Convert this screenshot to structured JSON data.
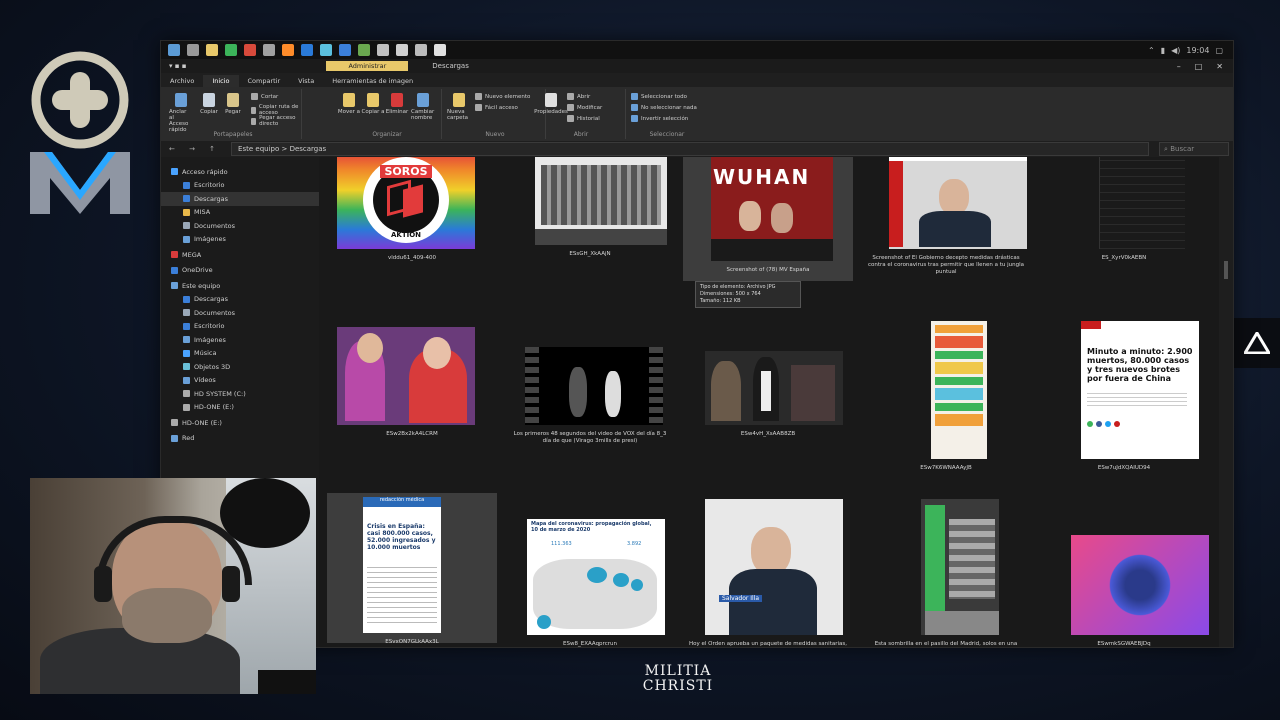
{
  "overlay": {
    "brand_text_line1": "MILITIA",
    "brand_text_line2": "CHRISTI"
  },
  "window": {
    "context_tab": "Administrar",
    "window_title": "Descargas",
    "controls": {
      "minimize": "–",
      "maximize": "□",
      "close": "✕"
    },
    "clock": "19:04",
    "ribbon_tabs": [
      "Archivo",
      "Inicio",
      "Compartir",
      "Vista",
      "Herramientas de imagen"
    ],
    "active_tab_index": 1
  },
  "ribbon": {
    "groups": [
      {
        "name": "Portapapeles",
        "buttons": [
          "Anclar al Acceso rápido",
          "Copiar",
          "Pegar"
        ],
        "small": [
          "Cortar",
          "Copiar ruta de acceso",
          "Pegar acceso directo"
        ]
      },
      {
        "name": "Organizar",
        "buttons": [
          "Mover a",
          "Copiar a",
          "Eliminar",
          "Cambiar nombre"
        ]
      },
      {
        "name": "Nuevo",
        "buttons": [
          "Nueva carpeta"
        ],
        "small": [
          "Nuevo elemento",
          "Fácil acceso"
        ]
      },
      {
        "name": "Abrir",
        "buttons": [
          "Propiedades"
        ],
        "small": [
          "Abrir",
          "Modificar",
          "Historial"
        ]
      },
      {
        "name": "Seleccionar",
        "small": [
          "Seleccionar todo",
          "No seleccionar nada",
          "Invertir selección"
        ]
      }
    ]
  },
  "address": {
    "nav": "← → ↑",
    "path": "Este equipo  >  Descargas",
    "search_placeholder": "Buscar"
  },
  "nav_pane": {
    "items": [
      {
        "label": "Acceso rápido",
        "color": "#4aa3ff",
        "indent": 1,
        "selected": false
      },
      {
        "label": "Escritorio",
        "color": "#3b7fd9",
        "indent": 2,
        "selected": false
      },
      {
        "label": "Descargas",
        "color": "#3b7fd9",
        "indent": 2,
        "selected": true
      },
      {
        "label": "MISA",
        "color": "#e8b84a",
        "indent": 2,
        "selected": false
      },
      {
        "label": "Documentos",
        "color": "#9aa8b8",
        "indent": 2,
        "selected": false
      },
      {
        "label": "Imágenes",
        "color": "#6aa0d8",
        "indent": 2,
        "selected": false
      },
      {
        "label": "MEGA",
        "color": "#d83b3b",
        "indent": 1,
        "selected": false
      },
      {
        "label": "OneDrive",
        "color": "#3b7fd9",
        "indent": 1,
        "selected": false
      },
      {
        "label": "Este equipo",
        "color": "#6aa0d8",
        "indent": 1,
        "selected": false
      },
      {
        "label": "Descargas",
        "color": "#3b7fd9",
        "indent": 2,
        "selected": false
      },
      {
        "label": "Documentos",
        "color": "#9aa8b8",
        "indent": 2,
        "selected": false
      },
      {
        "label": "Escritorio",
        "color": "#3b7fd9",
        "indent": 2,
        "selected": false
      },
      {
        "label": "Imágenes",
        "color": "#6aa0d8",
        "indent": 2,
        "selected": false
      },
      {
        "label": "Música",
        "color": "#4aa3ff",
        "indent": 2,
        "selected": false
      },
      {
        "label": "Objetos 3D",
        "color": "#6ac0d8",
        "indent": 2,
        "selected": false
      },
      {
        "label": "Vídeos",
        "color": "#6aa0d8",
        "indent": 2,
        "selected": false
      },
      {
        "label": "HD SYSTEM (C:)",
        "color": "#aaaaaa",
        "indent": 2,
        "selected": false
      },
      {
        "label": "HD-ONE (E:)",
        "color": "#aaaaaa",
        "indent": 2,
        "selected": false
      },
      {
        "label": "HD-ONE (E:)",
        "color": "#aaaaaa",
        "indent": 1,
        "selected": false
      },
      {
        "label": "Red",
        "color": "#6aa0d8",
        "indent": 1,
        "selected": false
      }
    ]
  },
  "files": [
    {
      "name": "vlddu61_409-400",
      "kind": "soros",
      "selected": false
    },
    {
      "name": "ESsGH_XkAAjN",
      "kind": "building",
      "selected": false
    },
    {
      "name": "Screenshot of (78) MV España",
      "kind": "wuhan",
      "selected": true
    },
    {
      "name": "Screenshot of El Gobierno decepto medidas drásticas contra el coronavirus tras permitir que llenen a tu jungla puntual",
      "kind": "president",
      "selected": false
    },
    {
      "name": "ES_XyrV0kAEBN",
      "kind": "phone-dark",
      "selected": false
    },
    {
      "name": "ESw2Bx2kA4LCRM",
      "kind": "women",
      "selected": false
    },
    {
      "name": "Los primeros 48 segundos del video de VOX del día 8_3 día de que (Virago 3mills de presi)",
      "kind": "video",
      "selected": false
    },
    {
      "name": "ESw4vH_XsAAB8ZB",
      "kind": "event",
      "selected": false
    },
    {
      "name": "ESw7K6WNAAAyJB",
      "kind": "infographic",
      "selected": false
    },
    {
      "name": "ESw7uJdXQAIUD94",
      "kind": "news",
      "selected": false
    },
    {
      "name": "ESvxON7GLkAAx3L",
      "kind": "phone-news",
      "selected": true
    },
    {
      "name": "ESw8_EXAAqprcrun",
      "kind": "map",
      "selected": false
    },
    {
      "name": "Hoy el Orden aprueba un paquete de medidas sanitarias, económicas contra el COVIDIA, para hacer frente al coronavirus — Los apoyos el miembro de (Ü)",
      "kind": "minister",
      "selected": false
    },
    {
      "name": "Esta sombrilla en el pasillo del Madrid, solos en una mezquita. Normativa: Estado alertado, después de saber que Italia ha cerrado fronteras y llenan de prohibición",
      "kind": "market",
      "selected": false
    },
    {
      "name": "ESwmkSGWAEBJDq",
      "kind": "collage",
      "selected": false
    }
  ],
  "tooltip": {
    "line1": "Tipo de elemento: Archivo JPG",
    "line2": "Dimensiones: 500 x 764",
    "line3": "Tamaño: 112 KB"
  },
  "thumb_text": {
    "soros_top": "SOROS",
    "soros_bottom": "AKTION",
    "wuhan": "WUHAN",
    "news_headline": "Minuto a minuto: 2.900 muertos, 80.000 casos y tres nuevos brotes por fuera de China",
    "phone_news_header": "redacción médica",
    "phone_news_headline": "Crisis en España: casi 800.000 casos, 52.000 ingresados y 10.000 muertos",
    "map_title": "Mapa del coronavirus: propagación global, 10 de marzo de 2020",
    "map_stat1": "111.363",
    "map_stat2": "3.892",
    "president_header": "El Gobierno está desbordado",
    "minister_caption": "Salvador Illa"
  }
}
